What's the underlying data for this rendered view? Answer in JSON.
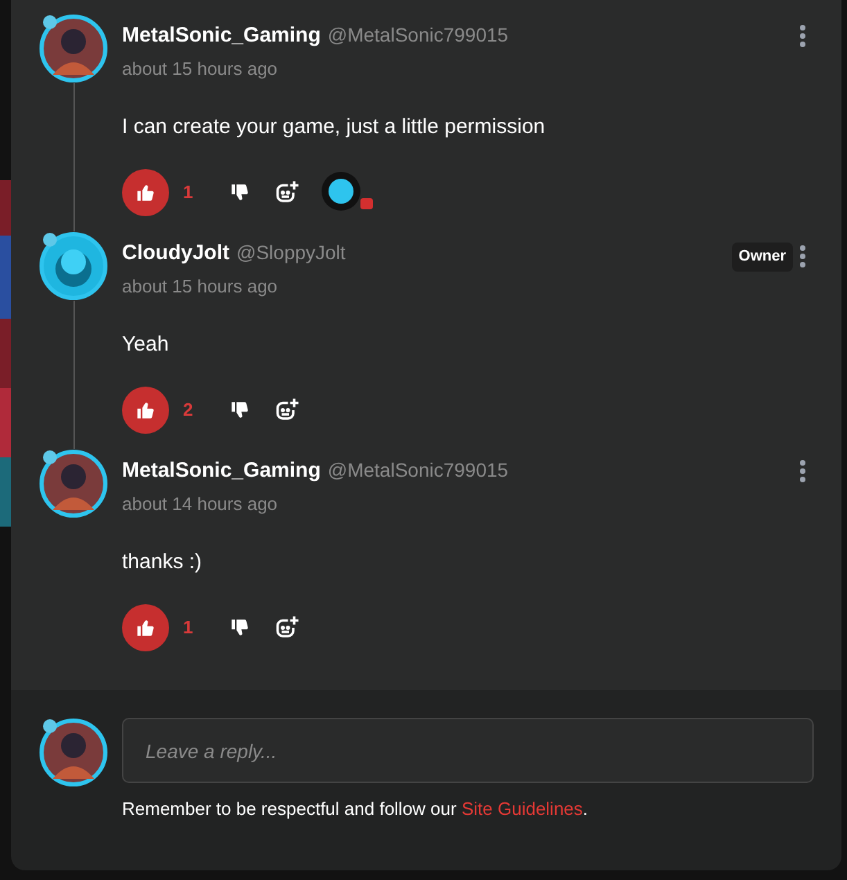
{
  "comments": [
    {
      "author": "MetalSonic_Gaming",
      "handle": "@MetalSonic799015",
      "time": "about 15 hours ago",
      "text": "I can create your game, just a little permission",
      "likes": "1",
      "liked": true,
      "kind": "metal",
      "reactor_shown": true
    },
    {
      "author": "CloudyJolt",
      "handle": "@SloppyJolt",
      "time": "about 15 hours ago",
      "text": "Yeah",
      "badge": "Owner",
      "likes": "2",
      "liked": true,
      "kind": "cloudy",
      "reactor_shown": false
    },
    {
      "author": "MetalSonic_Gaming",
      "handle": "@MetalSonic799015",
      "time": "about 14 hours ago",
      "text": "thanks :)",
      "likes": "1",
      "liked": true,
      "kind": "metal",
      "reactor_shown": false
    }
  ],
  "reply": {
    "placeholder": "Leave a reply...",
    "note": "Remember to be respectful and follow our ",
    "link": "Site Guidelines",
    "note_end": "."
  }
}
